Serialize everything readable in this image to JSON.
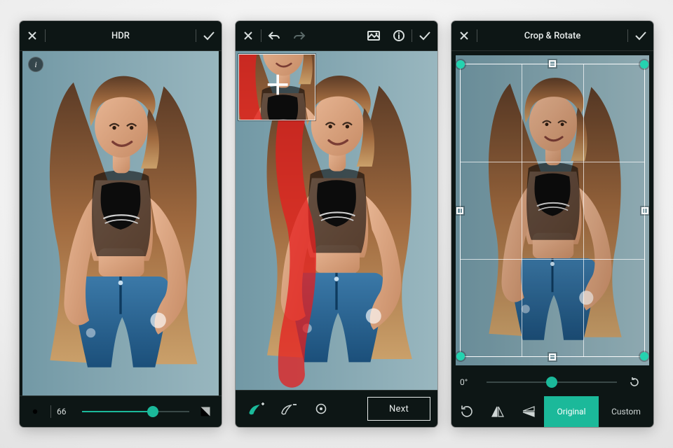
{
  "accent": "#1bb99a",
  "phone1": {
    "title": "HDR",
    "brightness_value": "66",
    "slider_percent": 66
  },
  "phone2": {
    "next_label": "Next"
  },
  "phone3": {
    "title": "Crop & Rotate",
    "angle_label": "0°",
    "slider_percent": 50,
    "tabs": {
      "original": "Original",
      "custom": "Custom"
    }
  }
}
